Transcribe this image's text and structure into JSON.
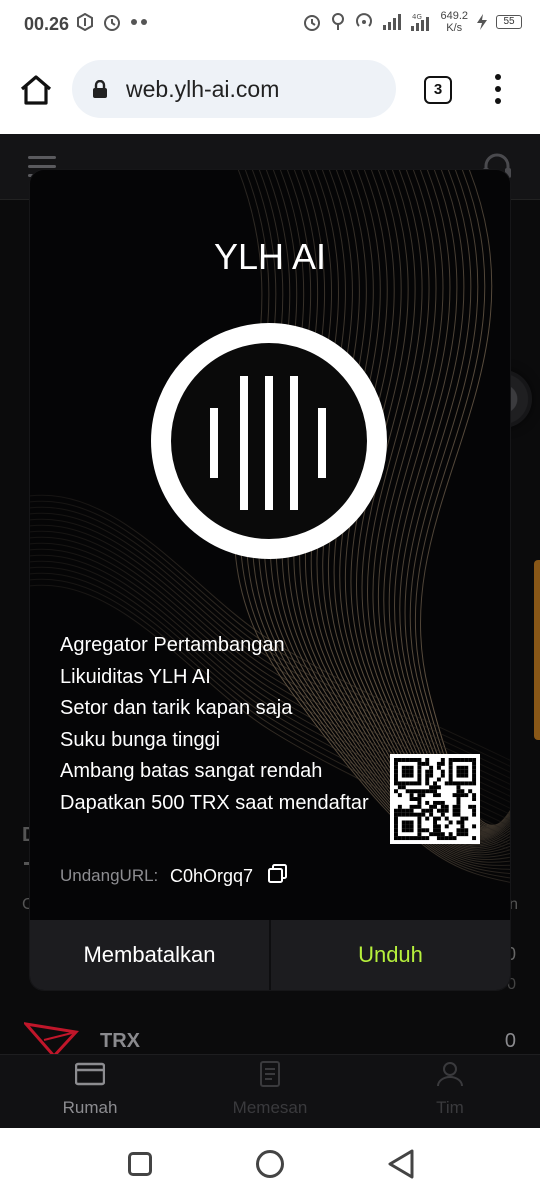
{
  "status_bar": {
    "time": "00.26",
    "net_speed_value": "649.2",
    "net_speed_unit": "K/s",
    "network": "4G",
    "battery": "55"
  },
  "browser": {
    "url": "web.ylh-ai.com",
    "tab_count": "3"
  },
  "page": {
    "bg_letter": "D",
    "bg_c": "C",
    "bg_h": "n",
    "bg_zero1": "0",
    "bg_zero2": "0",
    "coin_name": "TRX",
    "coin_value": "0",
    "nav": {
      "home": "Rumah",
      "order": "Memesan",
      "team": "Tim"
    }
  },
  "modal": {
    "title": "YLH AI",
    "lines": [
      "Agregator Pertambangan",
      "Likuiditas YLH AI",
      "Setor dan tarik kapan saja",
      "Suku bunga tinggi",
      "Ambang batas sangat rendah",
      "Dapatkan 500 TRX saat mendaftar"
    ],
    "invite_label": "UndangURL:",
    "invite_code": "C0hOrgq7",
    "cancel_label": "Membatalkan",
    "download_label": "Unduh",
    "accent_color": "#b6f03c"
  }
}
